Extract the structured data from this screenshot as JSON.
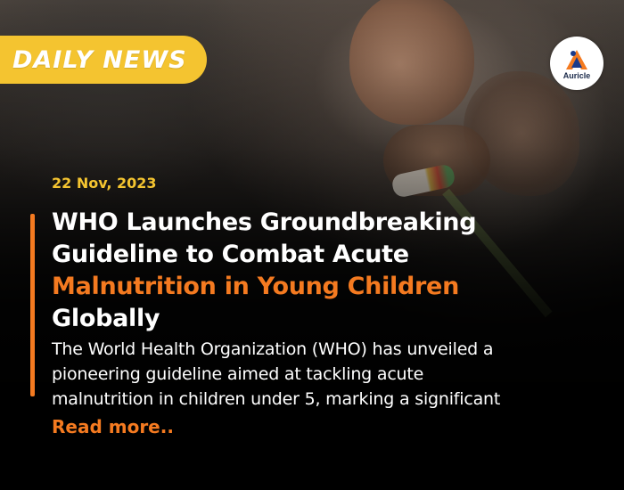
{
  "banner": {
    "label": "DAILY NEWS"
  },
  "brand": {
    "name": "Auricle",
    "icon": "auricle-logo-icon"
  },
  "article": {
    "date": "22 Nov, 2023",
    "headline_line1": "WHO Launches Groundbreaking",
    "headline_line2": "Guideline to Combat Acute",
    "headline_highlight": "Malnutrition in Young Children",
    "headline_line4": "Globally",
    "summary_line1": "The World Health Organization (WHO) has unveiled a",
    "summary_line2": "pioneering guideline aimed at tackling acute",
    "summary_line3": "malnutrition in children under 5, marking a significant",
    "read_more": "Read more.."
  },
  "colors": {
    "banner_yellow": "#f4c430",
    "accent_orange": "#f47a20",
    "text_white": "#ffffff",
    "background_dark": "#000000"
  }
}
